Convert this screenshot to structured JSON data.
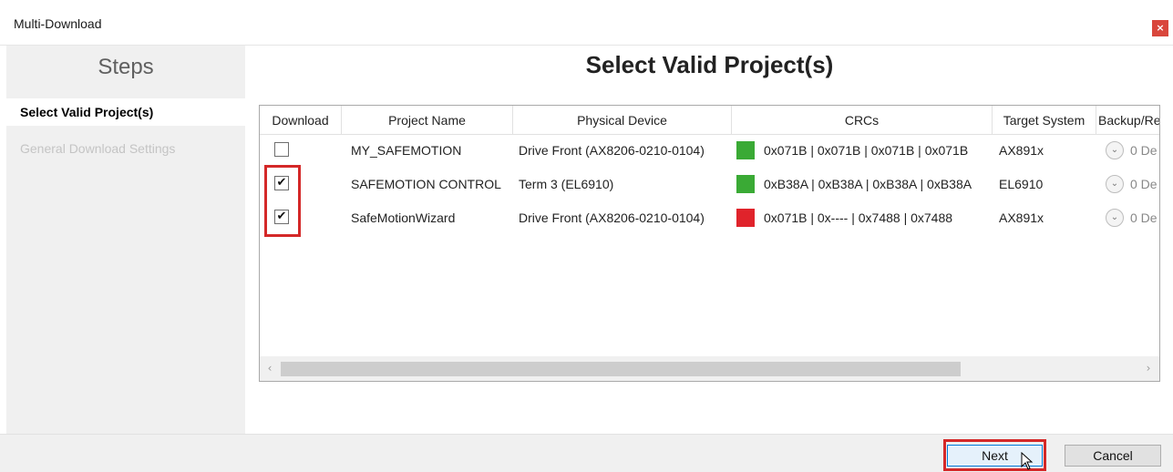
{
  "window": {
    "title": "Multi-Download",
    "close_glyph": "×"
  },
  "sidebar": {
    "heading": "Steps",
    "steps": [
      {
        "label": "Select Valid Project(s)",
        "active": true
      },
      {
        "label": "General Download Settings",
        "active": false
      }
    ]
  },
  "main": {
    "title": "Select Valid Project(s)",
    "columns": [
      "Download",
      "Project Name",
      "Physical Device",
      "CRCs",
      "Target System",
      "Backup/Re"
    ],
    "rows": [
      {
        "checked": false,
        "check_glyph": "",
        "project": "MY_SAFEMOTION",
        "device": "Drive Front (AX8206-0210-0104)",
        "crc_color": "#3aaa35",
        "crcs": "0x071B | 0x071B | 0x071B | 0x071B",
        "target": "AX891x",
        "backup": "0 De"
      },
      {
        "checked": true,
        "check_glyph": "✔",
        "project": "SAFEMOTION CONTROL",
        "device": "Term 3 (EL6910)",
        "crc_color": "#3aaa35",
        "crcs": "0xB38A | 0xB38A | 0xB38A | 0xB38A",
        "target": "EL6910",
        "backup": "0 De"
      },
      {
        "checked": true,
        "check_glyph": "✔",
        "project": "SafeMotionWizard",
        "device": "Drive Front (AX8206-0210-0104)",
        "crc_color": "#e0232b",
        "crcs": "0x071B | 0x---- | 0x7488 | 0x7488",
        "target": "AX891x",
        "backup": "0 De"
      }
    ],
    "scroll_left_glyph": "‹",
    "scroll_right_glyph": "›",
    "dropdown_glyph": "⌄"
  },
  "footer": {
    "next_label": "Next",
    "cancel_label": "Cancel"
  },
  "colors": {
    "highlight": "#d42828",
    "crc_ok": "#3aaa35",
    "crc_error": "#e0232b",
    "accent": "#0078d7"
  }
}
